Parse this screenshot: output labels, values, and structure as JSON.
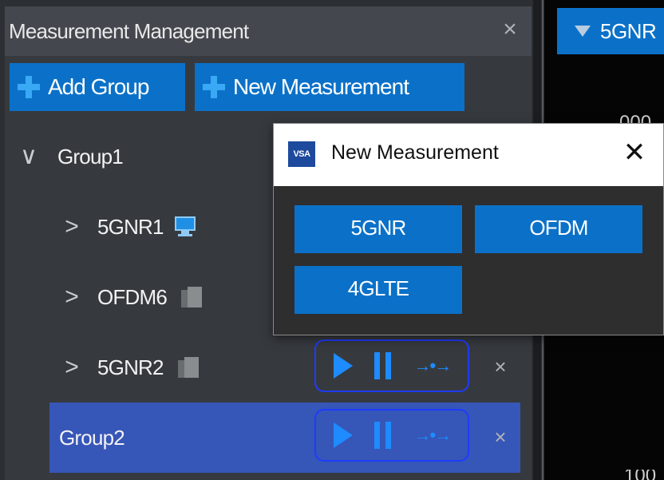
{
  "panel": {
    "title": "Measurement Management",
    "close_glyph": "×",
    "add_group_label": "Add Group",
    "new_measurement_label": "New Measurement"
  },
  "tree": [
    {
      "label": "Group1",
      "expanded": true,
      "chevron": "∨"
    },
    {
      "label": "5GNR1",
      "expanded": false,
      "chevron": ">",
      "icon": "monitor-icon"
    },
    {
      "label": "OFDM6",
      "expanded": false,
      "chevron": ">",
      "icon": "package-icon"
    },
    {
      "label": "5GNR2",
      "expanded": false,
      "chevron": ">",
      "icon": "package-icon"
    },
    {
      "label": "Group2",
      "selected": true
    }
  ],
  "controls": {
    "step_glyph": "→•→",
    "close_glyph": "×"
  },
  "right_panel": {
    "tab_label": "5GNR",
    "axis_top_text": "000",
    "axis_bottom_text": "100"
  },
  "dialog": {
    "logo_text": "VSA",
    "title": "New Measurement",
    "close_glyph": "✕",
    "buttons": [
      "5GNR",
      "OFDM",
      "4GLTE"
    ]
  },
  "colors": {
    "accent_blue": "#0b71c8",
    "selected_row": "#3656b8",
    "control_blue": "#1e8bff",
    "panel_bg": "#363a3f",
    "header_bg": "#44484e"
  }
}
